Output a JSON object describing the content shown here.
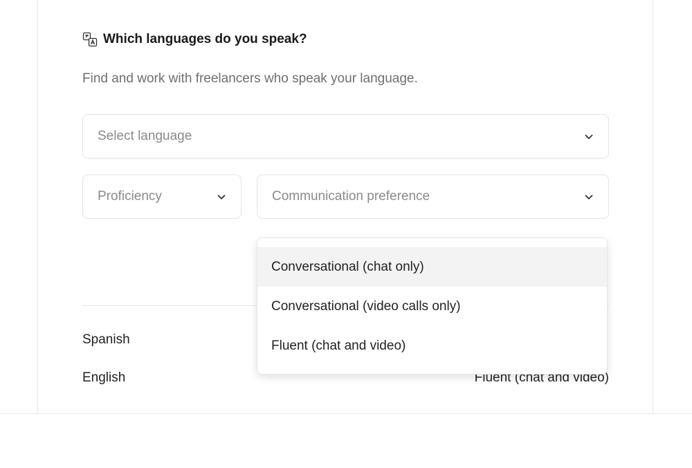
{
  "section": {
    "icon": "translate-icon",
    "title": "Which languages do you speak?",
    "subtitle": "Find and work with freelancers who speak your language."
  },
  "selects": {
    "language_placeholder": "Select language",
    "proficiency_placeholder": "Proficiency",
    "communication_placeholder": "Communication preference",
    "chevron_icon": "chevron-down-icon"
  },
  "dropdown": {
    "options": [
      {
        "label": "Conversational (chat only)",
        "highlighted": true
      },
      {
        "label": "Conversational (video calls only)",
        "highlighted": false
      },
      {
        "label": "Fluent (chat and video)",
        "highlighted": false
      }
    ]
  },
  "languages": [
    {
      "name": "Spanish",
      "level": ""
    },
    {
      "name": "English",
      "level": "Fluent (chat and video)"
    }
  ],
  "colors": {
    "border": "#e4e4e4",
    "highlight": "#f3f3f3",
    "placeholder": "#8a8a8a",
    "muted_text": "#6f6f6f"
  }
}
